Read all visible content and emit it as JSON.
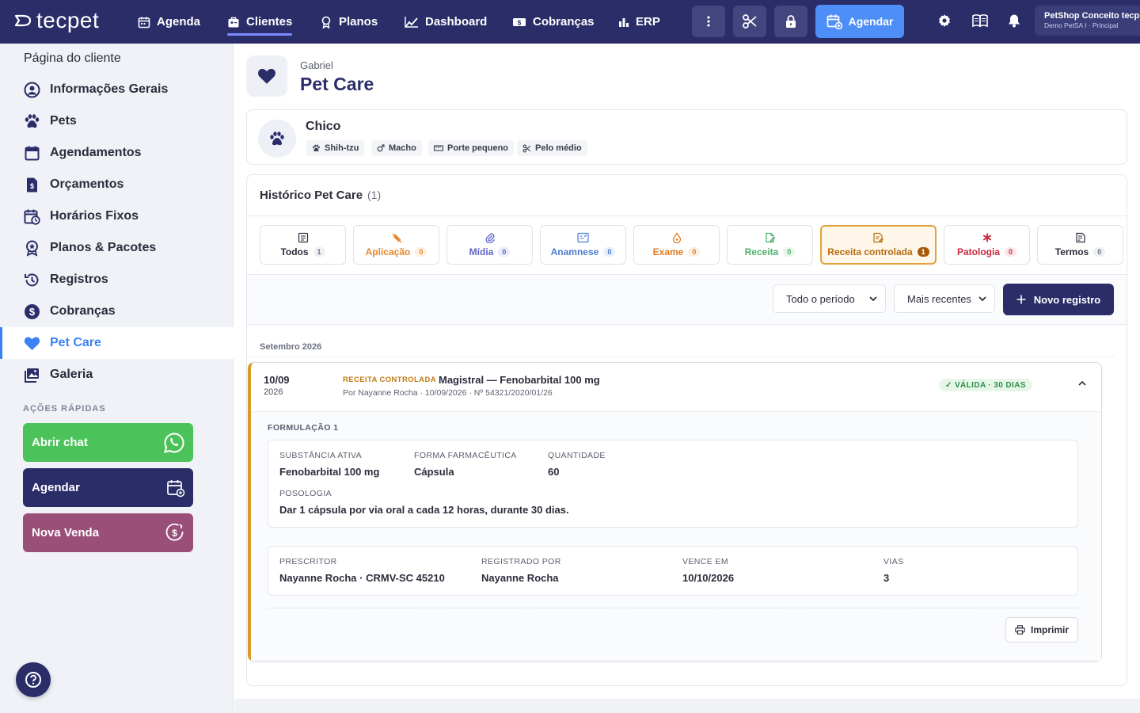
{
  "topnav": {
    "logo": "tecpet",
    "items": [
      {
        "label": "Agenda",
        "icon": "calendar-icon"
      },
      {
        "label": "Clientes",
        "icon": "clients-icon",
        "active": true
      },
      {
        "label": "Planos",
        "icon": "badge-icon"
      },
      {
        "label": "Dashboard",
        "icon": "chart-line-icon"
      },
      {
        "label": "Cobranças",
        "icon": "money-icon"
      },
      {
        "label": "ERP",
        "icon": "bar-chart-icon"
      }
    ],
    "agendar_label": "Agendar",
    "shop_name": "PetShop Conceito tecpet",
    "shop_sub": "Demo PetSA I · Principal"
  },
  "sidebar": {
    "title": "Página do cliente",
    "items": [
      {
        "label": "Informações Gerais",
        "icon": "user-circle-icon"
      },
      {
        "label": "Pets",
        "icon": "paw-icon"
      },
      {
        "label": "Agendamentos",
        "icon": "calendar-icon"
      },
      {
        "label": "Orçamentos",
        "icon": "invoice-icon"
      },
      {
        "label": "Horários Fixos",
        "icon": "calendar-clock-icon"
      },
      {
        "label": "Planos & Pacotes",
        "icon": "award-icon"
      },
      {
        "label": "Registros",
        "icon": "history-icon"
      },
      {
        "label": "Cobranças",
        "icon": "dollar-circle-icon"
      },
      {
        "label": "Pet Care",
        "icon": "heart-icon",
        "active": true
      },
      {
        "label": "Galeria",
        "icon": "gallery-icon"
      }
    ],
    "quick_actions_label": "AÇÕES RÁPIDAS",
    "quick_actions": [
      {
        "label": "Abrir chat",
        "color": "#4cc35a",
        "icon": "whatsapp-icon"
      },
      {
        "label": "Agendar",
        "color": "#2b2d69",
        "icon": "calendar-add-icon"
      },
      {
        "label": "Nova Venda",
        "color": "#9a4f79",
        "icon": "sale-icon"
      }
    ]
  },
  "header": {
    "client_name": "Gabriel",
    "title": "Pet Care"
  },
  "pet": {
    "name": "Chico",
    "chips": [
      {
        "label": "Shih-tzu",
        "icon": "paw-icon"
      },
      {
        "label": "Macho",
        "icon": "male-icon"
      },
      {
        "label": "Porte pequeno",
        "icon": "ruler-icon"
      },
      {
        "label": "Pelo médio",
        "icon": "scissors-icon"
      }
    ]
  },
  "history": {
    "title": "Histórico Pet Care",
    "count": "(1)",
    "tabs": [
      {
        "label": "Todos",
        "count": "1",
        "color": "#2b2d3c"
      },
      {
        "label": "Aplicação",
        "count": "0",
        "color": "#e8862b"
      },
      {
        "label": "Mídia",
        "count": "0",
        "color": "#5e63c9"
      },
      {
        "label": "Anamnese",
        "count": "0",
        "color": "#4a7bd0"
      },
      {
        "label": "Exame",
        "count": "0",
        "color": "#e07a1f"
      },
      {
        "label": "Receita",
        "count": "0",
        "color": "#4bb06a"
      },
      {
        "label": "Receita controlada",
        "count": "1",
        "color": "#b86d10",
        "active": true
      },
      {
        "label": "Patologia",
        "count": "0",
        "color": "#c8283c"
      },
      {
        "label": "Termos",
        "count": "0",
        "color": "#2b2d3c"
      }
    ],
    "period_select": "Todo o período",
    "sort_select": "Mais recentes",
    "new_button": "Novo registro",
    "month": "Setembro 2026",
    "record": {
      "day": "10/09",
      "year": "2026",
      "type": "RECEITA CONTROLADA",
      "title": "Magistral — Fenobarbital 100 mg",
      "meta": "Por Nayanne Rocha · 10/09/2026 · Nº 54321/2020/01/26",
      "status": "✓ VÁLIDA · 30 DIAS",
      "formulation_label": "FORMULAÇÃO 1",
      "fields": {
        "substancia_label": "SUBSTÂNCIA ATIVA",
        "substancia": "Fenobarbital 100 mg",
        "forma_label": "FORMA FARMACÊUTICA",
        "forma": "Cápsula",
        "quantidade_label": "QUANTIDADE",
        "quantidade": "60",
        "posologia_label": "POSOLOGIA",
        "posologia": "Dar 1 cápsula por via oral a cada 12 horas, durante 30 dias."
      },
      "footer": {
        "prescritor_label": "PRESCRITOR",
        "prescritor": "Nayanne Rocha · CRMV-SC 45210",
        "registrado_label": "REGISTRADO POR",
        "registrado": "Nayanne Rocha",
        "vence_label": "VENCE EM",
        "vence": "10/10/2026",
        "vias_label": "VIAS",
        "vias": "3"
      },
      "print_label": "Imprimir"
    }
  }
}
